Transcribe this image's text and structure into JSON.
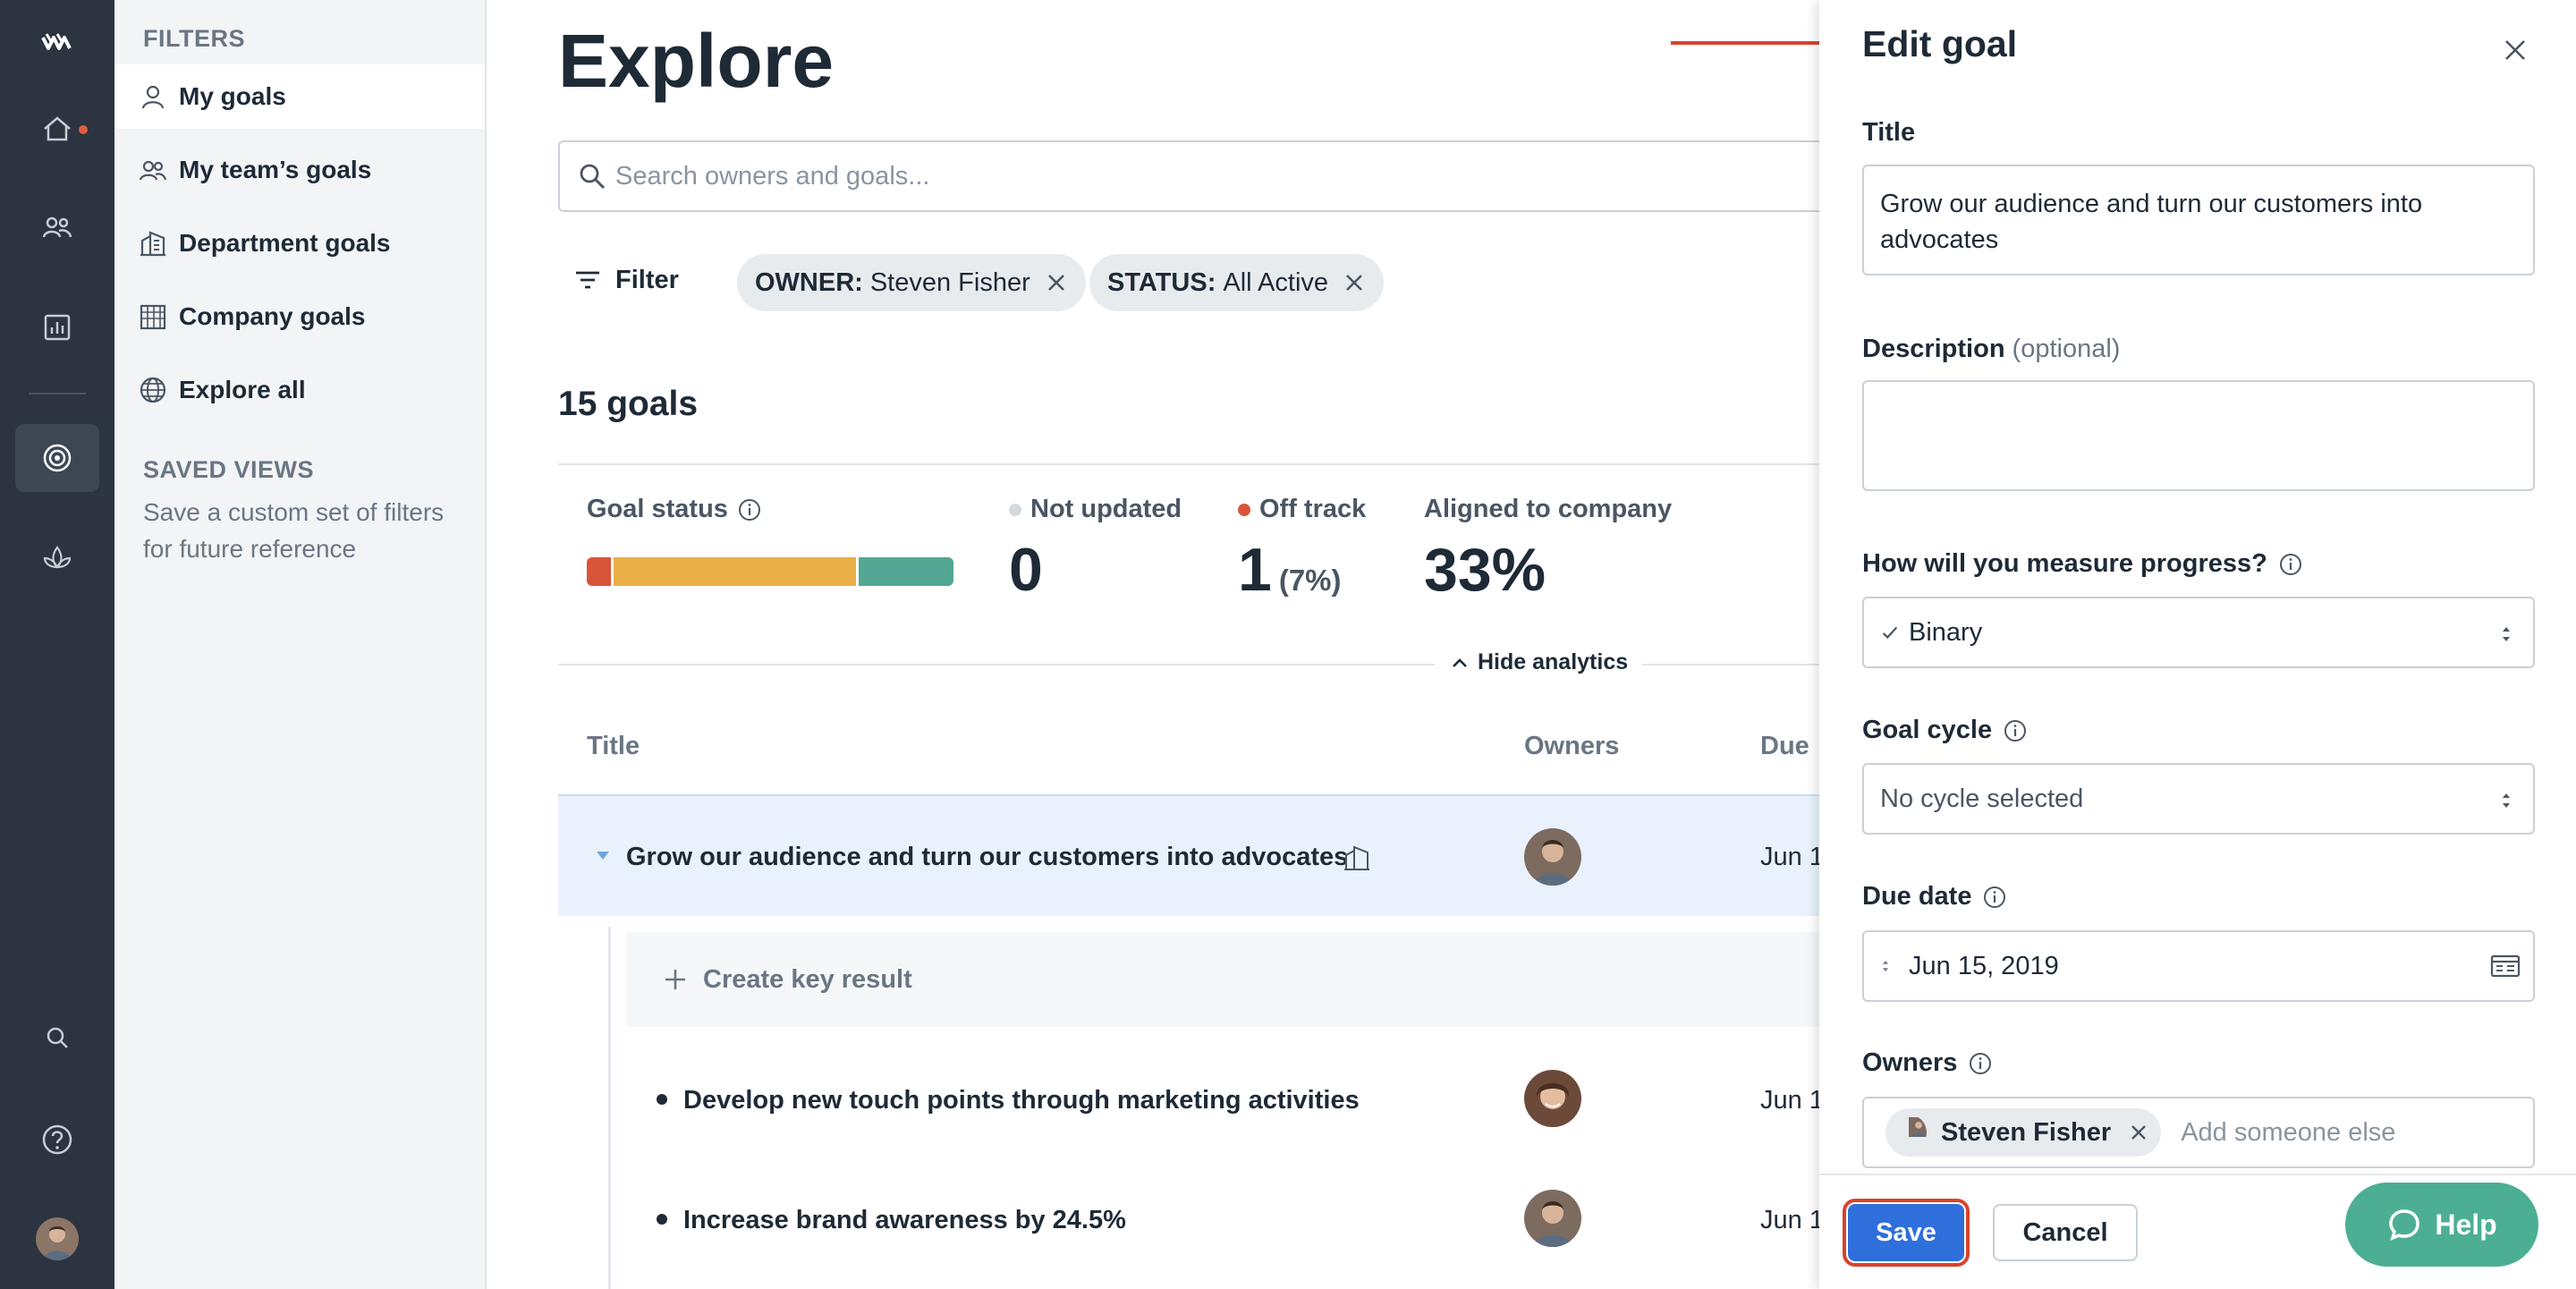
{
  "sidebar": {
    "filters_label": "FILTERS",
    "items": [
      {
        "label": "My goals"
      },
      {
        "label": "My team’s goals"
      },
      {
        "label": "Department goals"
      },
      {
        "label": "Company goals"
      },
      {
        "label": "Explore all"
      }
    ],
    "saved_views_label": "SAVED VIEWS",
    "saved_views_desc": "Save a custom set of filters for future reference"
  },
  "main": {
    "title": "Explore",
    "search_placeholder": "Search owners and goals...",
    "filter_label": "Filter",
    "chips": [
      {
        "key": "OWNER:",
        "value": "Steven Fisher"
      },
      {
        "key": "STATUS:",
        "value": "All Active"
      }
    ],
    "goals_count": "15 goals",
    "analytics": {
      "goal_status_label": "Goal status",
      "status_bar": {
        "off_track": 1,
        "at_risk": 10,
        "on_track": 4
      },
      "not_updated_label": "Not updated",
      "not_updated_value": "0",
      "off_track_label": "Off track",
      "off_track_value": "1",
      "off_track_pct": "(7%)",
      "aligned_label": "Aligned to company",
      "aligned_value": "33%",
      "hide_label": "Hide analytics"
    },
    "columns": {
      "title": "Title",
      "owners": "Owners",
      "due": "Due"
    },
    "rows": [
      {
        "title": "Grow our audience and turn our customers into advocates",
        "due": "Jun 1"
      },
      {
        "title": "Develop new touch points through marketing activities",
        "due": "Jun 1"
      },
      {
        "title": "Increase brand awareness by 24.5%",
        "due": "Jun 1"
      }
    ],
    "create_kr_label": "Create key result"
  },
  "panel": {
    "title": "Edit goal",
    "title_label": "Title",
    "title_value": "Grow our audience and turn our customers into advocates",
    "description_label": "Description",
    "description_optional": "(optional)",
    "description_value": "",
    "measure_label": "How will you measure progress?",
    "measure_value": "Binary",
    "cycle_label": "Goal cycle",
    "cycle_value": "No cycle selected",
    "due_label": "Due date",
    "due_value": "Jun 15, 2019",
    "owners_label": "Owners",
    "owner_name": "Steven Fisher",
    "owner_placeholder": "Add someone else",
    "save_label": "Save",
    "cancel_label": "Cancel",
    "help_label": "Help"
  },
  "colors": {
    "rail": "#2b3440",
    "off_track": "#d9553a",
    "at_risk": "#e9ae45",
    "on_track": "#52a892",
    "primary": "#2f6fdb",
    "annotation": "#d9432b"
  }
}
